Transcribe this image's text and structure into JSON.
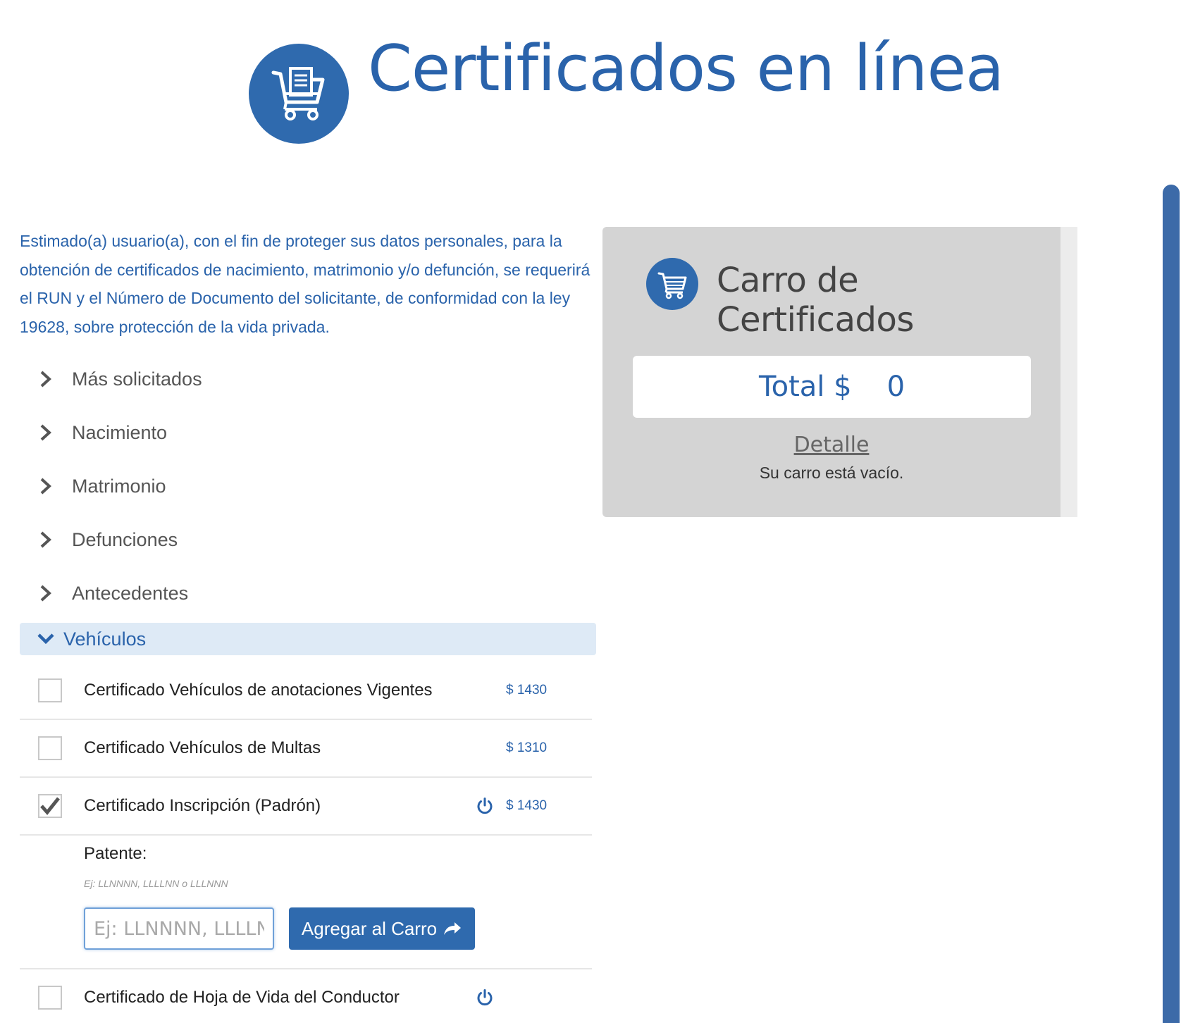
{
  "header": {
    "title": "Certificados en línea",
    "logo_icon": "shopping-cart-document-icon"
  },
  "intro": {
    "text": "Estimado(a) usuario(a), con el fin de proteger sus datos personales, para la obtención de certificados de nacimiento, matrimonio y/o defunción, se requerirá el RUN y el Número de Documento del solicitante, de conformidad con la ley 19628, sobre protección de la vida privada."
  },
  "categories": [
    {
      "label": "Más solicitados",
      "expanded": false
    },
    {
      "label": "Nacimiento",
      "expanded": false
    },
    {
      "label": "Matrimonio",
      "expanded": false
    },
    {
      "label": "Defunciones",
      "expanded": false
    },
    {
      "label": "Antecedentes",
      "expanded": false
    },
    {
      "label": "Vehículos",
      "expanded": true
    }
  ],
  "certificates": [
    {
      "label": "Certificado Vehículos de anotaciones Vigentes",
      "price": "$ 1430",
      "checked": false,
      "has_power_icon": false
    },
    {
      "label": "Certificado Vehículos de Multas",
      "price": "$ 1310",
      "checked": false,
      "has_power_icon": false
    },
    {
      "label": "Certificado Inscripción (Padrón)",
      "price": "$ 1430",
      "checked": true,
      "has_power_icon": true
    },
    {
      "label": "Certificado de Hoja de Vida del Conductor",
      "price": "",
      "checked": false,
      "has_power_icon": true
    }
  ],
  "patente": {
    "label": "Patente:",
    "hint": "Ej: LLNNNN, LLLLNN o LLLNNN",
    "input_value": "",
    "input_placeholder": "Ej: LLNNNN, LLLLNN o LLLNNN",
    "button_label": "Agregar al Carro",
    "button_icon": "share-arrow-icon"
  },
  "cart": {
    "title": "Carro de Certificados",
    "total_label": "Total $",
    "total_value": "0",
    "detail_link": "Detalle",
    "empty_message": "Su carro está vacío."
  },
  "colors": {
    "brand_blue": "#2f6aae",
    "text_blue": "#2a63ab",
    "panel_gray": "#d4d4d4",
    "open_row_bg": "#deeaf6",
    "scrollbar": "#3c6aa8"
  }
}
